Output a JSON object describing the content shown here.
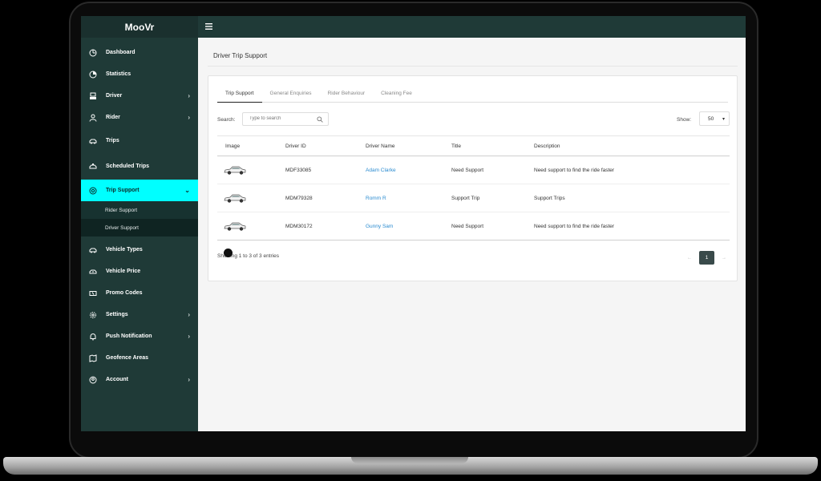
{
  "app": {
    "brand": "MooVr"
  },
  "sidebar": {
    "items": [
      {
        "label": "Dashboard",
        "icon": "dashboard-icon",
        "chevron": false
      },
      {
        "label": "Statistics",
        "icon": "pie-chart-icon",
        "chevron": false
      },
      {
        "label": "Driver",
        "icon": "driver-icon",
        "chevron": true
      },
      {
        "label": "Rider",
        "icon": "rider-icon",
        "chevron": true
      },
      {
        "label": "Trips",
        "icon": "car-icon",
        "chevron": false
      },
      {
        "label": "Scheduled Trips",
        "icon": "taxi-icon",
        "chevron": false
      },
      {
        "label": "Trip Support",
        "icon": "support-icon",
        "chevron": true,
        "active": true
      },
      {
        "label": "Vehicle Types",
        "icon": "car-icon",
        "chevron": false
      },
      {
        "label": "Vehicle Price",
        "icon": "price-icon",
        "chevron": false
      },
      {
        "label": "Promo Codes",
        "icon": "ticket-icon",
        "chevron": false
      },
      {
        "label": "Settings",
        "icon": "gear-icon",
        "chevron": true
      },
      {
        "label": "Push Notification",
        "icon": "bell-icon",
        "chevron": true
      },
      {
        "label": "Geofence Areas",
        "icon": "map-icon",
        "chevron": false
      },
      {
        "label": "Account",
        "icon": "user-icon",
        "chevron": true
      }
    ],
    "submenu": [
      {
        "label": "Rider Support"
      },
      {
        "label": "Driver Support",
        "current": true
      }
    ]
  },
  "page": {
    "title": "Driver Trip Support"
  },
  "tabs": [
    {
      "label": "Trip Support",
      "active": true
    },
    {
      "label": "General Enquiries"
    },
    {
      "label": "Rider Behaviour"
    },
    {
      "label": "Cleaning Fee"
    }
  ],
  "search": {
    "label": "Search:",
    "placeholder": "Type to search"
  },
  "show": {
    "label": "Show:",
    "value": "50"
  },
  "table": {
    "headers": [
      "Image",
      "Driver ID",
      "Driver Name",
      "Title",
      "Description"
    ],
    "rows": [
      {
        "driver_id": "MDF33085",
        "driver_name": "Adam Clarke",
        "title": "Need Support",
        "description": "Need support to find the ride faster"
      },
      {
        "driver_id": "MDM79328",
        "driver_name": "Romm R",
        "title": "Support Trip",
        "description": "Support Trips"
      },
      {
        "driver_id": "MDM30172",
        "driver_name": "Gunny Sam",
        "title": "Need Support",
        "description": "Need support to find the ride faster"
      }
    ]
  },
  "footer": {
    "info": "Showing 1 to 3 of 3 entries",
    "page": "1",
    "prev": "←",
    "next": "→"
  },
  "colors": {
    "sidebar": "#1f3a37",
    "active": "#00ffff",
    "link": "#2a8bd0",
    "pager": "#394a4a"
  }
}
